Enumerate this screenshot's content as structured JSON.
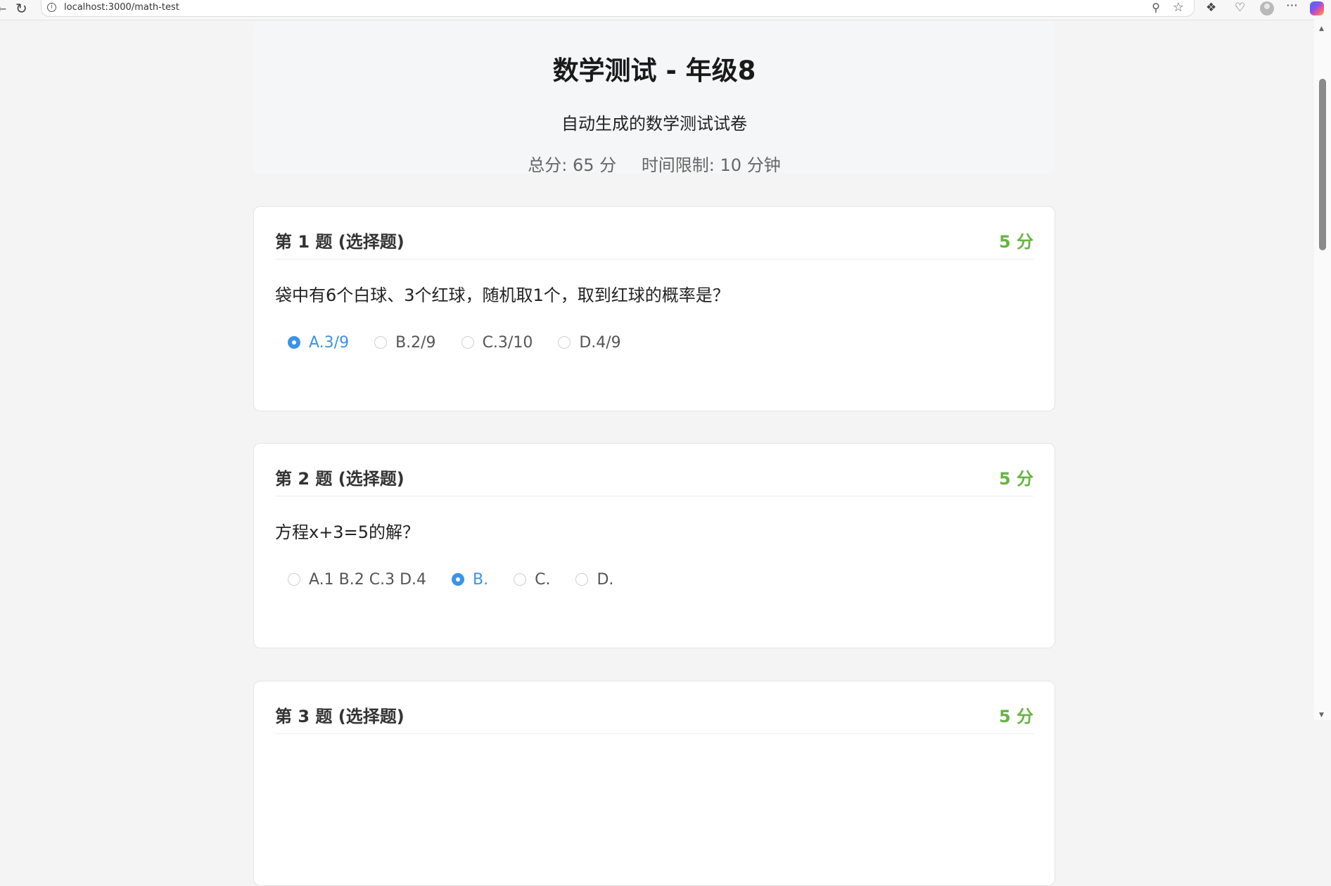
{
  "browser": {
    "url": "localhost:3000/math-test"
  },
  "test": {
    "title": "数学测试 - 年级8",
    "subtitle": "自动生成的数学测试试卷",
    "total_score": "总分: 65 分",
    "time_limit": "时间限制: 10 分钟"
  },
  "questions": [
    {
      "title": "第 1 题 (选择题)",
      "score": "5 分",
      "text": "袋中有6个白球、3个红球，随机取1个，取到红球的概率是？",
      "options": [
        {
          "label": "A.3/9",
          "selected": true
        },
        {
          "label": "B.2/9",
          "selected": false
        },
        {
          "label": "C.3/10",
          "selected": false
        },
        {
          "label": "D.4/9",
          "selected": false
        }
      ]
    },
    {
      "title": "第 2 题 (选择题)",
      "score": "5 分",
      "text": "方程x+3=5的解？",
      "options": [
        {
          "label": "A.1 B.2 C.3 D.4",
          "selected": false
        },
        {
          "label": "B.",
          "selected": true
        },
        {
          "label": "C.",
          "selected": false
        },
        {
          "label": "D.",
          "selected": false
        }
      ]
    },
    {
      "title": "第 3 题 (选择题)",
      "score": "5 分"
    }
  ],
  "colors": {
    "accent": "#3b93e8",
    "score": "#67b442",
    "background": "#f4f4f4"
  }
}
